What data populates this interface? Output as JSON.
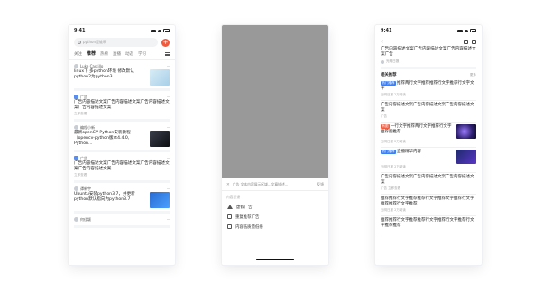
{
  "status_time": "9:41",
  "phone1": {
    "search_placeholder": "python是谁啊",
    "tabs": [
      "关注",
      "推荐",
      "热榜",
      "直播",
      "动态",
      "学习"
    ],
    "cards": [
      {
        "author": "Luke Castillo",
        "title": "linux下 多python环境 修改默认python2为python3",
        "meta": "",
        "thumb": "t1"
      },
      {
        "author": "广告",
        "title": "广告内容描述文案广告内容描述文案广告内容描述文案广告内容描述文案",
        "meta": "立即查看",
        "thumb": ""
      },
      {
        "author": "编程小新",
        "title": "最新openCV-Python安装教程（opencv-python版本4.4.0, Python…",
        "meta": "",
        "thumb": "t2"
      },
      {
        "author": "广告",
        "title": "广告内容描述文案广告内容描述文案广告内容描述文案广告内容描述文案",
        "meta": "立即查看",
        "thumb": ""
      },
      {
        "author": "谭新宇",
        "title": "Ubuntu安装python3.7，并更新python默认指向为python3.7",
        "meta": "",
        "thumb": "t3"
      },
      {
        "author": "何佳颖",
        "title": "",
        "meta": "",
        "thumb": ""
      }
    ]
  },
  "phone2": {
    "header_text": "广告 文本内容展示区域...文章描述...",
    "header_action": "反馈",
    "section_label": "内容反馈",
    "options": [
      "虚假广告",
      "重复推荐广告",
      "内容低质量低俗"
    ]
  },
  "phone3": {
    "article_title": "广告内容描述文案广告内容描述文案广告内容描述文案广告",
    "source": "光明日报",
    "related_header": "相关推荐",
    "related_more": "更多",
    "related": [
      {
        "tag": "热门推荐",
        "tag_color": "blue",
        "title": "推荐两行文字推荐推荐行文字推荐行文字文字",
        "meta": "光明日报 2万阅读",
        "thumb": ""
      },
      {
        "tag": "",
        "tag_color": "",
        "title": "广告内容描述文案广告内容描述文案广告内容描述文案",
        "meta": "广告",
        "thumb": ""
      },
      {
        "tag": "有图",
        "tag_color": "red",
        "title": "一行文字推荐两行文字推荐行文字推荐图推荐",
        "meta": "光明日报 2万阅读",
        "thumb": "t4"
      },
      {
        "tag": "热门推荐",
        "tag_color": "blue",
        "title": "直播精华内容",
        "meta": "光明日报 2万阅读",
        "thumb": "t5"
      },
      {
        "tag": "",
        "tag_color": "",
        "title": "广告内容描述文案广告内容描述文案广告内容描述文案",
        "meta": "广告 立即查看",
        "thumb": ""
      },
      {
        "tag": "",
        "tag_color": "",
        "title": "推荐推荐行文字推荐推荐行文字推荐文字推荐行文字推荐推荐行文字推荐",
        "meta": "光明日报 2万阅读",
        "thumb": ""
      },
      {
        "tag": "",
        "tag_color": "",
        "title": "推荐推荐行文字推荐推荐行文字推荐行文字推荐行文字推荐推荐",
        "meta": "",
        "thumb": ""
      }
    ]
  }
}
